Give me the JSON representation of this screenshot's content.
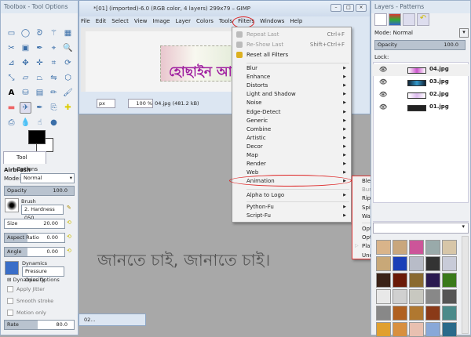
{
  "toolbox": {
    "title": "Toolbox - Tool Options",
    "tools": [
      "rect-select",
      "ellipse-select",
      "free-select",
      "fuzzy-select",
      "color-select",
      "scissors",
      "foreground-select",
      "paths",
      "color-picker",
      "zoom",
      "measure",
      "move",
      "align",
      "crop",
      "rotate",
      "scale",
      "shear",
      "perspective",
      "flip",
      "cage",
      "text",
      "bucket-fill",
      "blend",
      "pencil",
      "paintbrush",
      "eraser",
      "airbrush",
      "ink",
      "clone",
      "heal",
      "perspective-clone",
      "blur",
      "smudge",
      "dodge-burn"
    ],
    "tab_label": "Tool Options",
    "tool_name": "Airbrush",
    "mode_label": "Mode:",
    "mode_value": "Normal",
    "opacity_label": "Opacity",
    "opacity_value": "100.0",
    "brush_label": "Brush",
    "brush_value": "2. Hardness 050",
    "size_label": "Size",
    "size_value": "20.00",
    "aspect_label": "Aspect Ratio",
    "aspect_value": "0.00",
    "angle_label": "Angle",
    "angle_value": "0.00",
    "dynamics_label": "Dynamics",
    "dynamics_value": "Pressure Opacity",
    "dynamics_options": "Dynamics Options",
    "apply_jitter": "Apply Jitter",
    "smooth_stroke": "Smooth stroke",
    "motion_only": "Motion only",
    "rate_label": "Rate",
    "rate_value": "80.0"
  },
  "image_window": {
    "title": "*[01] (imported)-6.0 (RGB color, 4 layers) 299x79 – GIMP",
    "menus": [
      "File",
      "Edit",
      "Select",
      "View",
      "Image",
      "Layer",
      "Colors",
      "Tools",
      "Filters",
      "Windows",
      "Help"
    ],
    "banner_text": "হোছাইন আ",
    "unit": "px",
    "zoom": "100 %",
    "status": "04.jpg (481.2 kB)"
  },
  "filters_menu": {
    "top": [
      {
        "label": "Repeat Last",
        "shortcut": "Ctrl+F",
        "disabled": true
      },
      {
        "label": "Re-Show Last",
        "shortcut": "Shift+Ctrl+F",
        "disabled": true
      },
      {
        "label": "Reset all Filters",
        "shortcut": "",
        "disabled": false
      }
    ],
    "groups": [
      "Blur",
      "Enhance",
      "Distorts",
      "Light and Shadow",
      "Noise",
      "Edge-Detect",
      "Generic",
      "Combine",
      "Artistic",
      "Decor",
      "Map",
      "Render",
      "Web",
      "Animation"
    ],
    "alpha": "Alpha to Logo",
    "python": "Python-Fu",
    "script": "Script-Fu"
  },
  "animation_submenu": {
    "items": [
      {
        "label": "Blend...",
        "disabled": false
      },
      {
        "label": "Burn-In...",
        "disabled": true
      },
      {
        "label": "Rippling...",
        "disabled": false
      },
      {
        "label": "Spinning Globe...",
        "disabled": false
      },
      {
        "label": "Waves...",
        "disabled": false
      }
    ],
    "items2": [
      "Optimize (Difference)",
      "Optimize (for GIF)",
      "Playback...",
      "Unoptimize"
    ]
  },
  "layers_panel": {
    "title": "Layers - Patterns",
    "mode_label": "Mode:",
    "mode_value": "Normal",
    "opacity_label": "Opacity",
    "opacity_value": "100.0",
    "lock_label": "Lock:",
    "layers": [
      "04.jpg",
      "03.jpg",
      "02.jpg",
      "01.jpg"
    ]
  },
  "canvas_text": "জানতে চাই, জানাতে চাই।",
  "minimized_window": "02...",
  "colors": {
    "highlight_ring": "#dd2222",
    "banner_text": "#a020a0"
  }
}
